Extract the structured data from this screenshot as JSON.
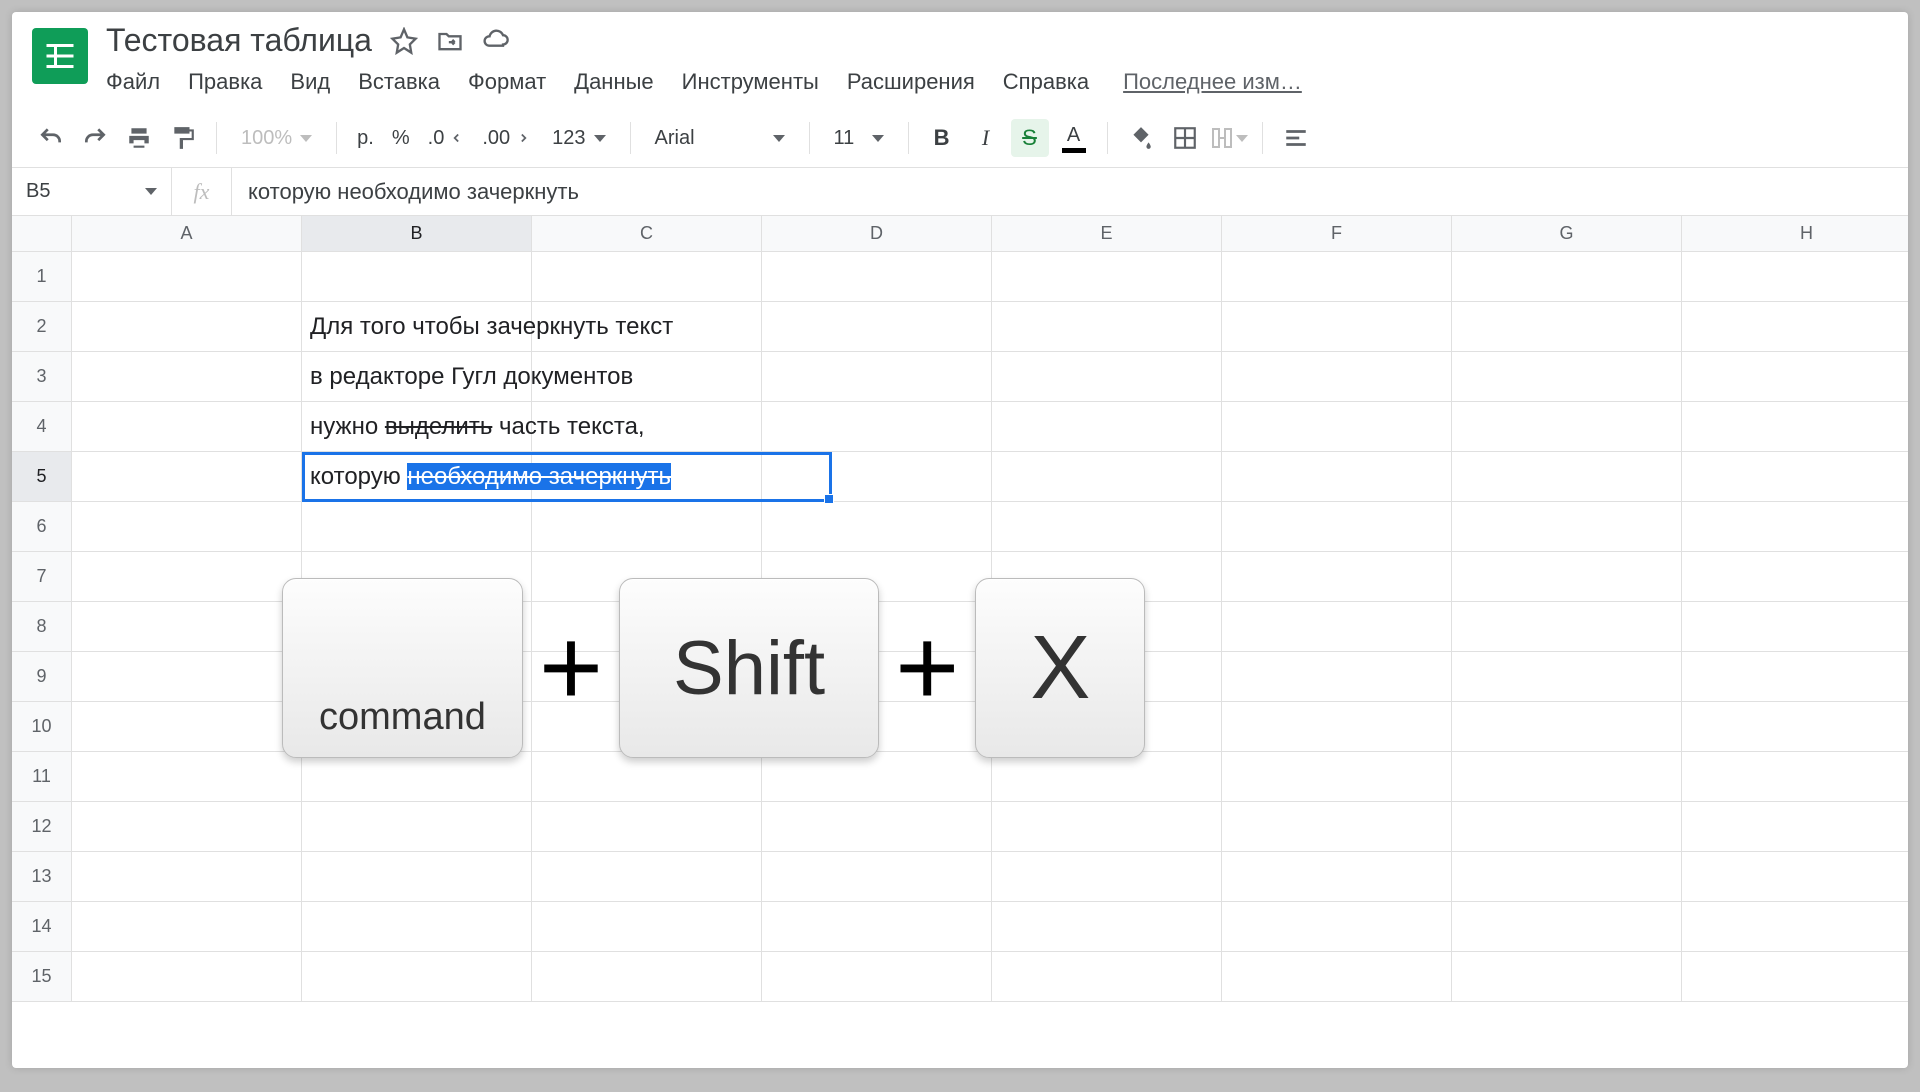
{
  "doc_title": "Тестовая таблица",
  "menu": [
    "Файл",
    "Правка",
    "Вид",
    "Вставка",
    "Формат",
    "Данные",
    "Инструменты",
    "Расширения",
    "Справка"
  ],
  "last_edit": "Последнее изм…",
  "toolbar": {
    "zoom": "100%",
    "currency": "р.",
    "percent": "%",
    "dec_dec": ".0",
    "dec_inc": ".00",
    "more_formats": "123",
    "font": "Arial",
    "font_size": "11",
    "bold": "B",
    "italic": "I",
    "strike": "S",
    "text_color": "A"
  },
  "name_box": "B5",
  "fx": "fx",
  "formula_value": "которую необходимо зачеркнуть",
  "columns": [
    "A",
    "B",
    "C",
    "D",
    "E",
    "F",
    "G",
    "H"
  ],
  "rows": [
    "1",
    "2",
    "3",
    "4",
    "5",
    "6",
    "7",
    "8",
    "9",
    "10",
    "11",
    "12",
    "13",
    "14",
    "15"
  ],
  "active_col": "B",
  "active_row": "5",
  "cells": {
    "b2": "Для того чтобы зачеркнуть текст",
    "b3": "в редакторе Гугл документов",
    "b4_pre": "нужно ",
    "b4_strike": "выделить",
    "b4_post": " часть текста,",
    "b5_pre": "которую ",
    "b5_sel": "необходимо зачеркнуть"
  },
  "shortcut": {
    "k1": "command",
    "plus": "+",
    "k2": "Shift",
    "k3": "X"
  }
}
